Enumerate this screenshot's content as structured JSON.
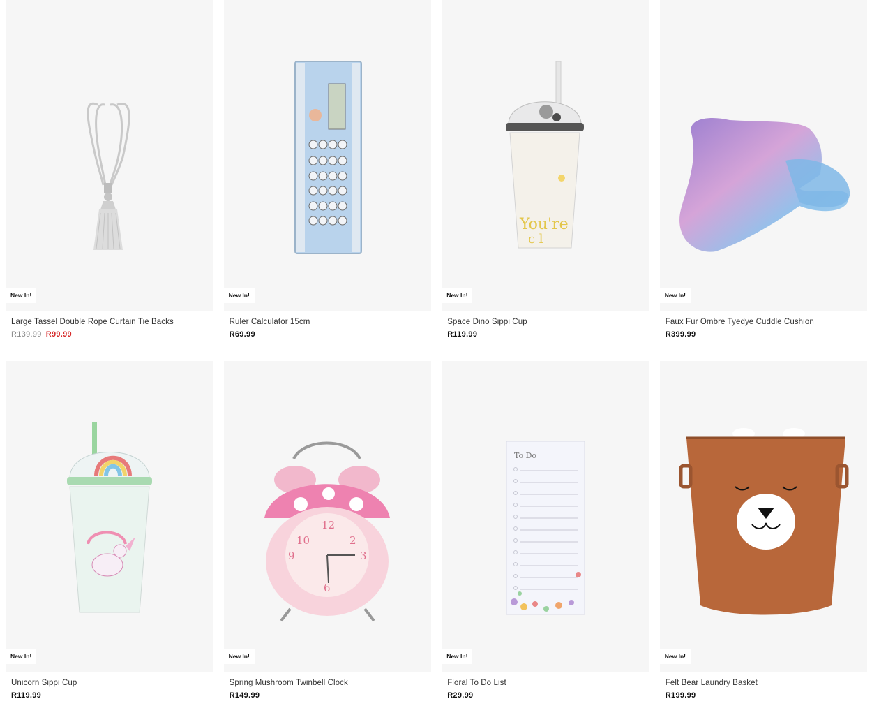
{
  "products": [
    {
      "name": "Large Tassel Double Rope Curtain Tie Backs",
      "badge": "New In!",
      "old_price": "R139.99",
      "price": "R99.99",
      "icon": "tassel-tie-back"
    },
    {
      "name": "Ruler Calculator 15cm",
      "badge": "New In!",
      "price": "R69.99",
      "icon": "ruler-calculator"
    },
    {
      "name": "Space Dino Sippi Cup",
      "badge": "New In!",
      "price": "R119.99",
      "icon": "sippy-cup-dino"
    },
    {
      "name": "Faux Fur Ombre Tyedye Cuddle Cushion",
      "badge": "New In!",
      "price": "R399.99",
      "icon": "cuddle-cushion"
    },
    {
      "name": "Unicorn Sippi Cup",
      "badge": "New In!",
      "price": "R119.99",
      "icon": "sippy-cup-unicorn"
    },
    {
      "name": "Spring Mushroom Twinbell Clock",
      "badge": "New In!",
      "price": "R149.99",
      "icon": "alarm-clock"
    },
    {
      "name": "Floral To Do List",
      "badge": "New In!",
      "price": "R29.99",
      "icon": "todo-notepad",
      "pad_heading": "To Do"
    },
    {
      "name": "Felt Bear Laundry Basket",
      "badge": "New In!",
      "price": "R199.99",
      "icon": "laundry-basket"
    }
  ],
  "colors": {
    "sale": "#d62b2b",
    "card_bg": "#f6f6f6"
  }
}
